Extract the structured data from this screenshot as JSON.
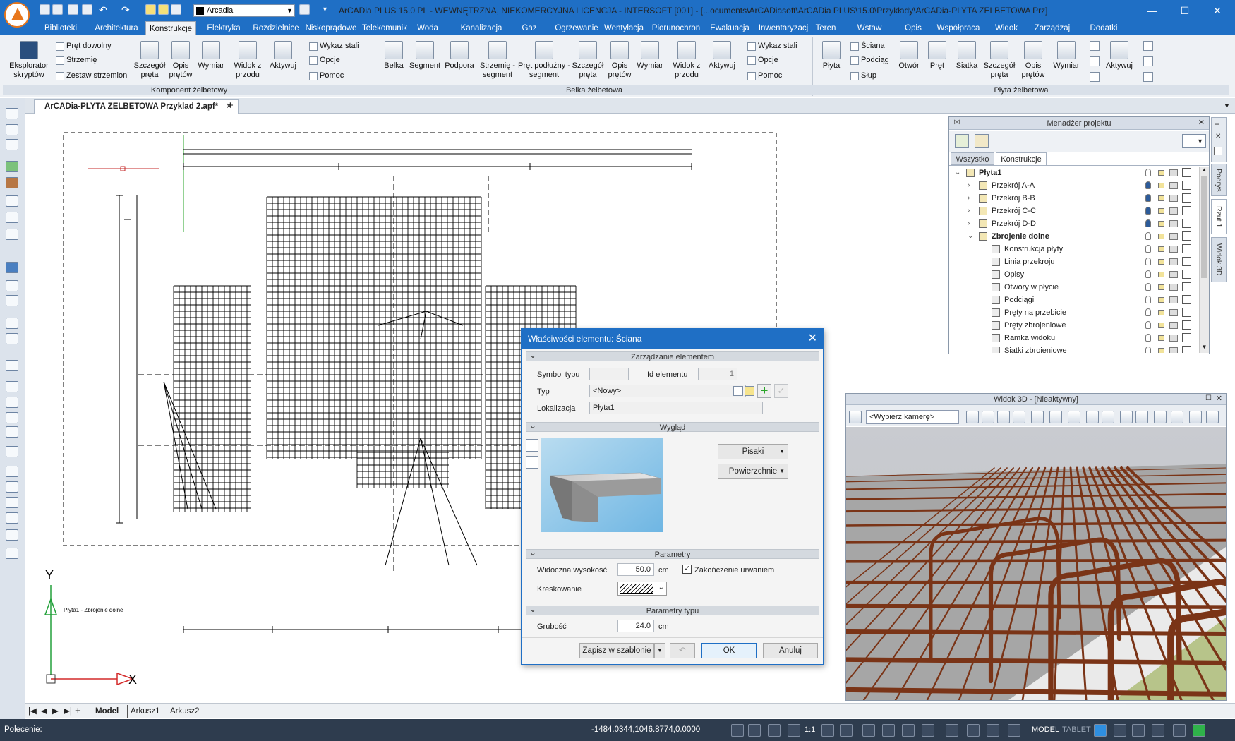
{
  "window": {
    "title": "ArCADia PLUS 15.0 PL - WEWNĘTRZNA, NIEKOMERCYJNA LICENCJA - INTERSOFT [001] - [...ocuments\\ArCADiasoft\\ArCADia PLUS\\15.0\\Przykłady\\ArCADia-PLYTA ZELBETOWA Prz]",
    "layer": "Arcadia"
  },
  "menu_tabs": [
    "Biblioteki",
    "Architektura",
    "Konstrukcje",
    "Elektryka",
    "Rozdzielnice",
    "Niskoprądowe",
    "Telekomunik",
    "Woda",
    "Kanalizacja",
    "Gaz",
    "Ogrzewanie",
    "Wentylacja",
    "Piorunochron",
    "Ewakuacja",
    "Inwentaryzacj",
    "Teren",
    "Wstaw",
    "Opis",
    "Współpraca",
    "Widok",
    "Zarządzaj",
    "Dodatki"
  ],
  "ribbon": {
    "groups": {
      "komponent": "Komponent żelbetowy",
      "belka": "Belka żelbetowa",
      "plyta": "Płyta żelbetowa"
    },
    "komponent": {
      "eksplorator": "Eksplorator skryptów",
      "pret_dowolny": "Pręt dowolny",
      "strzemie": "Strzemię",
      "zestaw": "Zestaw strzemion",
      "szczegol": "Szczegół pręta",
      "opis": "Opis prętów",
      "wymiar": "Wymiar",
      "widok": "Widok z przodu",
      "aktywuj": "Aktywuj",
      "wykaz": "Wykaz stali",
      "opcje": "Opcje",
      "pomoc": "Pomoc"
    },
    "belka": {
      "belka": "Belka",
      "segment": "Segment",
      "podpora": "Podpora",
      "strzemie_seg": "Strzemię - segment",
      "pret_podl": "Pręt podłużny - segment",
      "szczegol": "Szczegół pręta",
      "opis": "Opis prętów",
      "wymiar": "Wymiar",
      "widok": "Widok z przodu",
      "aktywuj": "Aktywuj",
      "wykaz": "Wykaz stali",
      "opcje": "Opcje",
      "pomoc": "Pomoc"
    },
    "plyta": {
      "plyta": "Płyta",
      "sciana": "Ściana",
      "podciag": "Podciąg",
      "slup": "Słup",
      "otwor": "Otwór",
      "pret": "Pręt",
      "siatka": "Siatka",
      "szczegol": "Szczegół pręta",
      "opis": "Opis prętów",
      "wymiar": "Wymiar",
      "aktywuj": "Aktywuj"
    }
  },
  "document_tab": "ArCADia-PLYTA ZELBETOWA Przyklad 2.apf*",
  "drawing": {
    "caption": "Płyta1 - Zbrojenie dolne",
    "axis_y": "Y",
    "axis_x": "X"
  },
  "sheet_tabs": [
    "Model",
    "Arkusz1",
    "Arkusz2"
  ],
  "status": {
    "prompt": "Polecenie:",
    "coords": "-1484.0344,1046.8774,0.0000",
    "scale": "1:1",
    "model": "MODEL",
    "tablet": "TABLET"
  },
  "project_manager": {
    "title": "Menadżer projektu",
    "tabs": [
      "Wszystko",
      "Konstrukcje"
    ],
    "tree": [
      {
        "label": "Płyta1",
        "level": 0,
        "bold": true,
        "bulb": "off"
      },
      {
        "label": "Przekrój A-A",
        "level": 1,
        "bold": false,
        "bulb": "on"
      },
      {
        "label": "Przekrój B-B",
        "level": 1,
        "bold": false,
        "bulb": "on"
      },
      {
        "label": "Przekrój C-C",
        "level": 1,
        "bold": false,
        "bulb": "on"
      },
      {
        "label": "Przekrój D-D",
        "level": 1,
        "bold": false,
        "bulb": "on"
      },
      {
        "label": "Zbrojenie dolne",
        "level": 1,
        "bold": true,
        "bulb": "off"
      },
      {
        "label": "Konstrukcja płyty",
        "level": 2,
        "bold": false,
        "bulb": "off"
      },
      {
        "label": "Linia przekroju",
        "level": 2,
        "bold": false,
        "bulb": "off"
      },
      {
        "label": "Opisy",
        "level": 2,
        "bold": false,
        "bulb": "off"
      },
      {
        "label": "Otwory w płycie",
        "level": 2,
        "bold": false,
        "bulb": "off"
      },
      {
        "label": "Podciągi",
        "level": 2,
        "bold": false,
        "bulb": "off"
      },
      {
        "label": "Pręty na przebicie",
        "level": 2,
        "bold": false,
        "bulb": "off"
      },
      {
        "label": "Pręty zbrojeniowe",
        "level": 2,
        "bold": false,
        "bulb": "off"
      },
      {
        "label": "Ramka widoku",
        "level": 2,
        "bold": false,
        "bulb": "off"
      },
      {
        "label": "Siatki zbrojeniowe",
        "level": 2,
        "bold": false,
        "bulb": "off"
      }
    ]
  },
  "side_tabs": [
    "Podrys",
    "Rzut 1",
    "Widok 3D"
  ],
  "view3d": {
    "title": "Widok 3D - [Nieaktywny]",
    "camera": "<Wybierz kamerę>"
  },
  "dialog": {
    "title": "Właściwości elementu: Ściana",
    "sec_management": "Zarządzanie elementem",
    "symbol_label": "Symbol typu",
    "id_label": "Id elementu",
    "id_value": "1",
    "type_label": "Typ",
    "type_value": "<Nowy>",
    "location_label": "Lokalizacja",
    "location_value": "Płyta1",
    "sec_appearance": "Wygląd",
    "pens": "Pisaki",
    "surfaces": "Powierzchnie",
    "sec_params": "Parametry",
    "visible_height_label": "Widoczna wysokość",
    "visible_height_value": "50.0",
    "unit": "cm",
    "break_end_label": "Zakończenie urwaniem",
    "hatch_label": "Kreskowanie",
    "sec_type_params": "Parametry typu",
    "thickness_label": "Grubość",
    "thickness_value": "24.0",
    "save_template": "Zapisz w szablonie",
    "ok": "OK",
    "cancel": "Anuluj"
  },
  "colors": {
    "accent": "#1f6fc5",
    "rebar": "#7a3417",
    "status_bg": "#2e3c4e"
  }
}
